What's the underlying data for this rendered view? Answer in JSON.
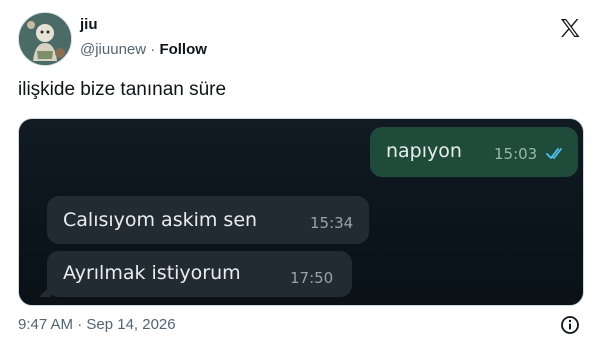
{
  "author": {
    "display_name": "jiu",
    "handle": "@jiuunew",
    "separator": "·",
    "follow_label": "Follow"
  },
  "tweet": {
    "text": "ilişkide bize tanınan süre",
    "timestamp": "9:47 AM · Sep 14, 2026"
  },
  "chat": {
    "messages": [
      {
        "direction": "outgoing",
        "text": "napıyon",
        "time": "15:03",
        "status_icon": "double-check-icon"
      },
      {
        "direction": "incoming",
        "text": "Calısıyom askim sen",
        "time": "15:34"
      },
      {
        "direction": "incoming",
        "text": "Ayrılmak istiyorum",
        "time": "17:50"
      }
    ]
  },
  "icons": {
    "brand": "x-logo-icon",
    "info": "info-icon"
  },
  "colors": {
    "chat_background": "#0b141b",
    "outgoing_bubble": "#1f4c3a",
    "incoming_bubble": "#232b32",
    "read_ticks": "#53bdeb",
    "secondary_text": "#536471"
  }
}
